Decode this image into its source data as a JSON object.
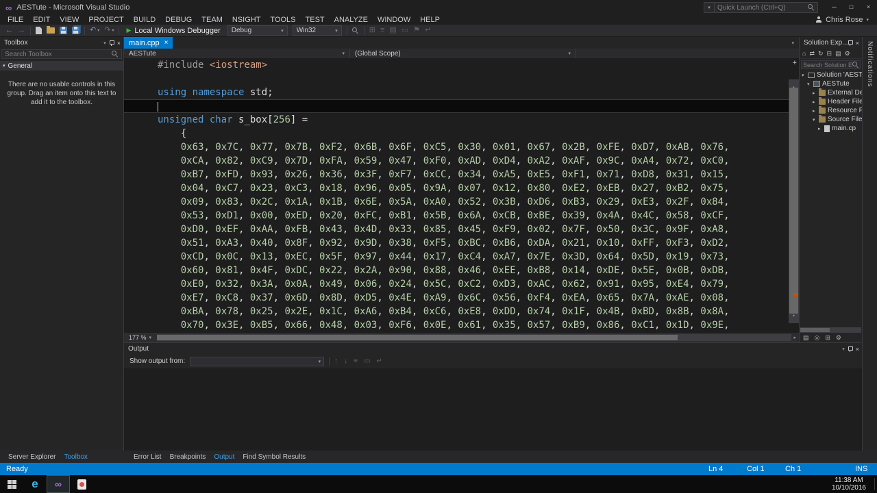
{
  "window": {
    "title": "AESTute - Microsoft Visual Studio",
    "quick_launch_placeholder": "Quick Launch (Ctrl+Q)",
    "user_name": "Chris Rose"
  },
  "icons": {
    "close": "×",
    "minimize": "─",
    "maximize": "□",
    "chevron_down": "▾",
    "chevron_up": "▴",
    "chevron_right": "▸",
    "back": "←",
    "forward": "→",
    "undo": "↶",
    "redo": "↷",
    "play": "▶",
    "home": "⌂",
    "refresh": "↻",
    "sync": "⇄",
    "collapse_all": "⊟",
    "gear": "⚙",
    "files": "▤",
    "plus": "+",
    "list": "≡",
    "flag": "⚑",
    "wrap": "↵",
    "up": "↑",
    "down": "↓",
    "grid": "⊞",
    "circle": "◎",
    "clear": "▭"
  },
  "menu": [
    "FILE",
    "EDIT",
    "VIEW",
    "PROJECT",
    "BUILD",
    "DEBUG",
    "TEAM",
    "NSIGHT",
    "TOOLS",
    "TEST",
    "ANALYZE",
    "WINDOW",
    "HELP"
  ],
  "toolbar": {
    "debug_target_label": "Local Windows Debugger",
    "configuration": "Debug",
    "platform": "Win32"
  },
  "toolbox": {
    "title": "Toolbox",
    "search_placeholder": "Search Toolbox",
    "section_label": "General",
    "emp6ty_message_note": "",
    "empty_message": "There are no usable controls in this group. Drag an item onto this text to add it to the toolbox."
  },
  "editor": {
    "tab_label": "main.cpp",
    "nav_project": "AESTute",
    "nav_scope": "(Global Scope)",
    "zoom_level": "177 %",
    "code_lines": [
      {
        "tokens": [
          [
            "pp",
            "#include "
          ],
          [
            "str",
            "<iostream>"
          ]
        ]
      },
      {
        "tokens": []
      },
      {
        "tokens": [
          [
            "kw",
            "using"
          ],
          [
            "pl",
            " "
          ],
          [
            "kw",
            "namespace"
          ],
          [
            "pl",
            " std;"
          ]
        ]
      },
      {
        "tokens": [],
        "current": true
      },
      {
        "tokens": [
          [
            "kw",
            "unsigned"
          ],
          [
            "pl",
            " "
          ],
          [
            "kw",
            "char"
          ],
          [
            "pl",
            " s_box["
          ],
          [
            "num",
            "256"
          ],
          [
            "pl",
            "] ="
          ]
        ]
      },
      {
        "tokens": [
          [
            "pl",
            "    {"
          ]
        ]
      },
      {
        "hex": "    0x63, 0x7C, 0x77, 0x7B, 0xF2, 0x6B, 0x6F, 0xC5, 0x30, 0x01, 0x67, 0x2B, 0xFE, 0xD7, 0xAB, 0x76,"
      },
      {
        "hex": "    0xCA, 0x82, 0xC9, 0x7D, 0xFA, 0x59, 0x47, 0xF0, 0xAD, 0xD4, 0xA2, 0xAF, 0x9C, 0xA4, 0x72, 0xC0,"
      },
      {
        "hex": "    0xB7, 0xFD, 0x93, 0x26, 0x36, 0x3F, 0xF7, 0xCC, 0x34, 0xA5, 0xE5, 0xF1, 0x71, 0xD8, 0x31, 0x15,"
      },
      {
        "hex": "    0x04, 0xC7, 0x23, 0xC3, 0x18, 0x96, 0x05, 0x9A, 0x07, 0x12, 0x80, 0xE2, 0xEB, 0x27, 0xB2, 0x75,"
      },
      {
        "hex": "    0x09, 0x83, 0x2C, 0x1A, 0x1B, 0x6E, 0x5A, 0xA0, 0x52, 0x3B, 0xD6, 0xB3, 0x29, 0xE3, 0x2F, 0x84,"
      },
      {
        "hex": "    0x53, 0xD1, 0x00, 0xED, 0x20, 0xFC, 0xB1, 0x5B, 0x6A, 0xCB, 0xBE, 0x39, 0x4A, 0x4C, 0x58, 0xCF,"
      },
      {
        "hex": "    0xD0, 0xEF, 0xAA, 0xFB, 0x43, 0x4D, 0x33, 0x85, 0x45, 0xF9, 0x02, 0x7F, 0x50, 0x3C, 0x9F, 0xA8,"
      },
      {
        "hex": "    0x51, 0xA3, 0x40, 0x8F, 0x92, 0x9D, 0x38, 0xF5, 0xBC, 0xB6, 0xDA, 0x21, 0x10, 0xFF, 0xF3, 0xD2,"
      },
      {
        "hex": "    0xCD, 0x0C, 0x13, 0xEC, 0x5F, 0x97, 0x44, 0x17, 0xC4, 0xA7, 0x7E, 0x3D, 0x64, 0x5D, 0x19, 0x73,"
      },
      {
        "hex": "    0x60, 0x81, 0x4F, 0xDC, 0x22, 0x2A, 0x90, 0x88, 0x46, 0xEE, 0xB8, 0x14, 0xDE, 0x5E, 0x0B, 0xDB,"
      },
      {
        "hex": "    0xE0, 0x32, 0x3A, 0x0A, 0x49, 0x06, 0x24, 0x5C, 0xC2, 0xD3, 0xAC, 0x62, 0x91, 0x95, 0xE4, 0x79,"
      },
      {
        "hex": "    0xE7, 0xC8, 0x37, 0x6D, 0x8D, 0xD5, 0x4E, 0xA9, 0x6C, 0x56, 0xF4, 0xEA, 0x65, 0x7A, 0xAE, 0x08,"
      },
      {
        "hex": "    0xBA, 0x78, 0x25, 0x2E, 0x1C, 0xA6, 0xB4, 0xC6, 0xE8, 0xDD, 0x74, 0x1F, 0x4B, 0xBD, 0x8B, 0x8A,"
      },
      {
        "hex": "    0x70, 0x3E, 0xB5, 0x66, 0x48, 0x03, 0xF6, 0x0E, 0x61, 0x35, 0x57, 0xB9, 0x86, 0xC1, 0x1D, 0x9E,"
      }
    ]
  },
  "solution_explorer": {
    "title": "Solution Exp...",
    "search_placeholder": "Search Solution E",
    "tree": [
      {
        "label": "Solution 'AESTute'",
        "indent": 0,
        "expand": "down",
        "icon": "solution"
      },
      {
        "label": "AESTute",
        "indent": 1,
        "expand": "down",
        "icon": "project"
      },
      {
        "label": "External Dep",
        "indent": 2,
        "expand": "right",
        "icon": "folder"
      },
      {
        "label": "Header File",
        "indent": 2,
        "expand": "right",
        "icon": "folder"
      },
      {
        "label": "Resource Fi",
        "indent": 2,
        "expand": "right",
        "icon": "folder"
      },
      {
        "label": "Source Files",
        "indent": 2,
        "expand": "down",
        "icon": "folder"
      },
      {
        "label": "main.cp",
        "indent": 3,
        "expand": "right",
        "icon": "cpp"
      }
    ]
  },
  "notifications_label": "Notifications",
  "output_panel": {
    "title": "Output",
    "show_output_from_label": "Show output from:"
  },
  "bottom_tabs": {
    "left": [
      {
        "label": "Server Explorer",
        "active": false
      },
      {
        "label": "Toolbox",
        "active": true
      }
    ],
    "right": [
      {
        "label": "Error List",
        "active": false
      },
      {
        "label": "Breakpoints",
        "active": false
      },
      {
        "label": "Output",
        "active": true
      },
      {
        "label": "Find Symbol Results",
        "active": false
      }
    ]
  },
  "status_bar": {
    "state": "Ready",
    "line": "Ln 4",
    "column": "Col 1",
    "character": "Ch 1",
    "mode": "INS"
  },
  "taskbar": {
    "time": "11:38 AM",
    "date": "10/10/2016"
  },
  "theme": {
    "accent": "#007acc",
    "keyword_color": "#569cd6",
    "string_color": "#d69d85",
    "number_color": "#b5cea8",
    "preprocessor_color": "#9b9b9b"
  }
}
